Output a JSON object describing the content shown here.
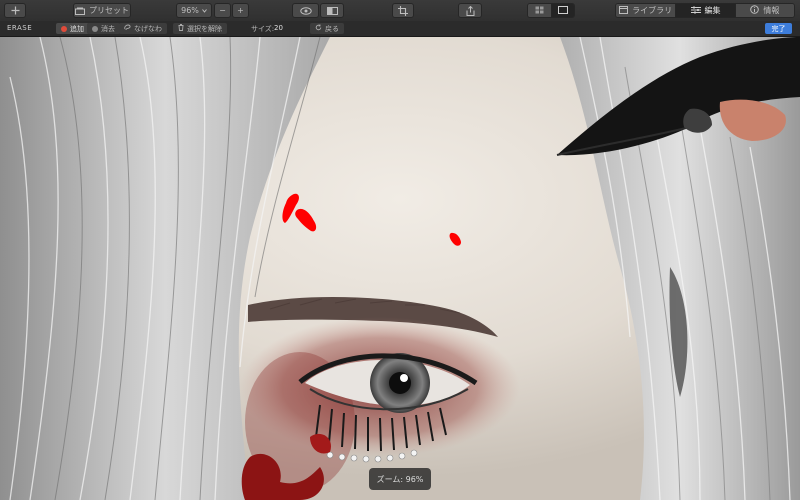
{
  "toolbar": {
    "add_icon": "plus-icon",
    "presets_label": "プリセット",
    "zoom_label": "96%",
    "zoom_out_label": "−",
    "zoom_in_label": "+",
    "library_label": "ライブラリ",
    "edit_label": "編集",
    "info_label": "情報"
  },
  "subbar": {
    "mode_label": "ERASE",
    "add_label": "追加",
    "erase_label": "消去",
    "smooth_label": "なげなわ",
    "clear_label": "選択を解除",
    "size_label": "サイズ:",
    "size_value": "20",
    "reset_label": "戻る",
    "done_label": "完了"
  },
  "canvas": {
    "zoom_hud": "ズーム: 96%",
    "accent_red": "#ff0000"
  }
}
